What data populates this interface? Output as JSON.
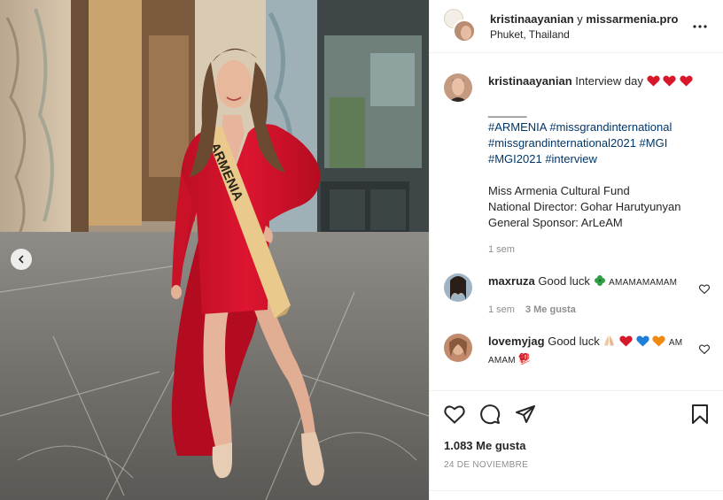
{
  "header": {
    "user1": "kristinaayanian",
    "joiner": "y",
    "user2": "missarmenia.pro",
    "location": "Phuket, Thailand"
  },
  "caption": {
    "username": "kristinaayanian",
    "text": "Interview day",
    "separator": "______",
    "hashtag_line1": "#ARMENIA #missgrandinternational",
    "hashtag_line2": "#missgrandinternational2021 #MGI",
    "hashtag_line3": "#MGI2021 #interview",
    "info_line1": "Miss Armenia Cultural Fund",
    "info_line2": "National Director: Gohar Harutyunyan",
    "info_line3": "General Sponsor: ArLeAM",
    "time": "1 sem"
  },
  "comments": [
    {
      "username": "maxruza",
      "text": "Good luck",
      "suffix": "AMAMAMAMAM",
      "time": "1 sem",
      "likes": "3 Me gusta"
    },
    {
      "username": "lovemyjag",
      "text": "Good luck",
      "suffix1": "AM",
      "suffix2": "AMAM"
    }
  ],
  "footer": {
    "likes": "1.083 Me gusta",
    "date": "24 DE NOVIEMBRE"
  },
  "photo": {
    "sash_text": "ARMENIA"
  },
  "colors": {
    "dress": "#d3122c",
    "sash": "#e9c98c",
    "link": "#00376b",
    "meta": "#8e8e8e"
  },
  "icons": [
    "more-options-icon",
    "heart-icon",
    "comment-icon",
    "share-icon",
    "bookmark-icon",
    "chevron-left-icon",
    "clover-icon",
    "pray-icon"
  ]
}
